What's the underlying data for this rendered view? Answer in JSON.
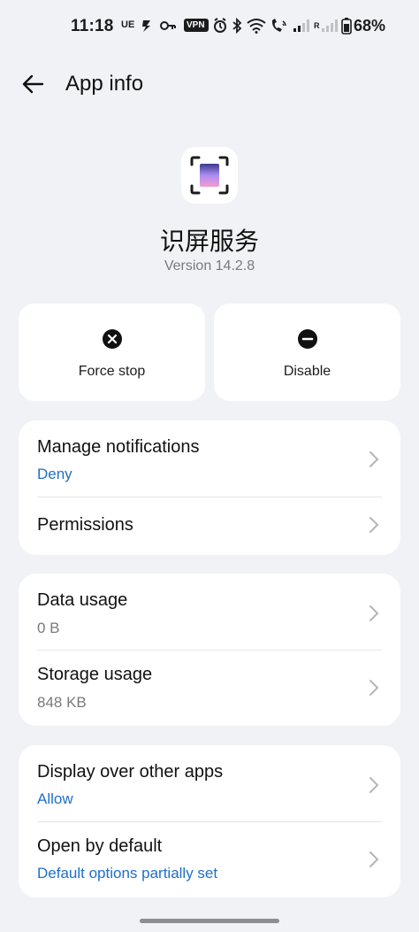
{
  "status_bar": {
    "time": "11:18",
    "ue": "UE",
    "vpn": "VPN",
    "signal_r": "R",
    "battery": "68%"
  },
  "header": {
    "title": "App info"
  },
  "app": {
    "name": "识屏服务",
    "version": "Version 14.2.8"
  },
  "actions": [
    {
      "label": "Force stop",
      "icon": "close-circle-icon"
    },
    {
      "label": "Disable",
      "icon": "minus-circle-icon"
    }
  ],
  "sections": [
    {
      "rows": [
        {
          "title": "Manage notifications",
          "subtitle": "Deny",
          "subtitle_color": "#1f6fc8"
        },
        {
          "title": "Permissions",
          "subtitle": ""
        }
      ]
    },
    {
      "rows": [
        {
          "title": "Data usage",
          "subtitle": "0 B",
          "subtitle_color": "#7a7a7e"
        },
        {
          "title": "Storage usage",
          "subtitle": "848 KB",
          "subtitle_color": "#7a7a7e"
        }
      ]
    },
    {
      "rows": [
        {
          "title": "Display over other apps",
          "subtitle": "Allow",
          "subtitle_color": "#1f6fc8"
        },
        {
          "title": "Open by default",
          "subtitle": "Default options partially set",
          "subtitle_color": "#1f6fc8"
        }
      ]
    }
  ],
  "colors": {
    "background": "#f1f2f5",
    "card": "#ffffff",
    "link": "#1f6fc8",
    "muted": "#7a7a7e"
  }
}
